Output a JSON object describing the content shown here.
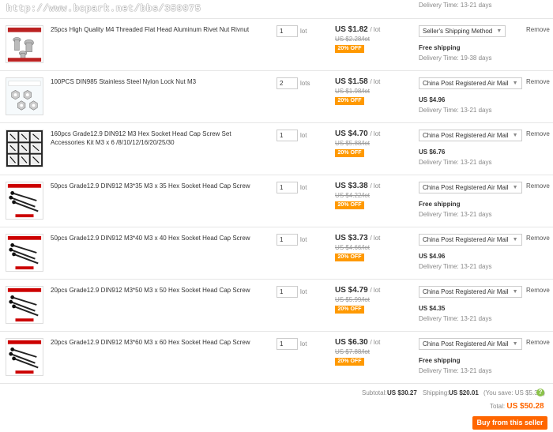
{
  "watermark": "http://www.bcpark.net/bbs/359975",
  "top_delivery": "Delivery Time: 13-21 days",
  "items": [
    {
      "title": "25pcs High Quality M4 Threaded Flat Head Aluminum Rivet Nut Rivnut",
      "qty": "1",
      "unit": "lot",
      "price": "US $1.82",
      "per": "/ lot",
      "orig": "US $2.28/lot",
      "off": "20% OFF",
      "ship": "Seller's Shipping Method",
      "cost": "Free shipping",
      "delivery": "Delivery Time: 19-38 days",
      "remove": "Remove",
      "thumb": "rivet"
    },
    {
      "title": "100PCS DIN985 Stainless Steel Nylon Lock Nut M3",
      "qty": "2",
      "unit": "lots",
      "price": "US $1.58",
      "per": "/ lot",
      "orig": "US $1.98/lot",
      "off": "20% OFF",
      "ship": "China Post Registered Air Mail",
      "cost": "US $4.96",
      "delivery": "Delivery Time: 13-21 days",
      "remove": "Remove",
      "thumb": "nut"
    },
    {
      "title": "160pcs Grade12.9 DIN912 M3 Hex Socket Head Cap Screw Set Accessories Kit M3 x 6 /8/10/12/16/20/25/30",
      "qty": "1",
      "unit": "lot",
      "price": "US $4.70",
      "per": "/ lot",
      "orig": "US $5.88/lot",
      "off": "20% OFF",
      "ship": "China Post Registered Air Mail",
      "cost": "US $6.76",
      "delivery": "Delivery Time: 13-21 days",
      "remove": "Remove",
      "thumb": "kit"
    },
    {
      "title": "50pcs Grade12.9 DIN912 M3*35 M3 x 35 Hex Socket Head Cap Screw",
      "qty": "1",
      "unit": "lot",
      "price": "US $3.38",
      "per": "/ lot",
      "orig": "US $4.22/lot",
      "off": "20% OFF",
      "ship": "China Post Registered Air Mail",
      "cost": "Free shipping",
      "delivery": "Delivery Time: 13-21 days",
      "remove": "Remove",
      "thumb": "screw"
    },
    {
      "title": "50pcs Grade12.9 DIN912 M3*40 M3 x 40 Hex Socket Head Cap Screw",
      "qty": "1",
      "unit": "lot",
      "price": "US $3.73",
      "per": "/ lot",
      "orig": "US $4.66/lot",
      "off": "20% OFF",
      "ship": "China Post Registered Air Mail",
      "cost": "US $4.96",
      "delivery": "Delivery Time: 13-21 days",
      "remove": "Remove",
      "thumb": "screw"
    },
    {
      "title": "20pcs Grade12.9 DIN912 M3*50 M3 x 50 Hex Socket Head Cap Screw",
      "qty": "1",
      "unit": "lot",
      "price": "US $4.79",
      "per": "/ lot",
      "orig": "US $5.99/lot",
      "off": "20% OFF",
      "ship": "China Post Registered Air Mail",
      "cost": "US $4.35",
      "delivery": "Delivery Time: 13-21 days",
      "remove": "Remove",
      "thumb": "screw"
    },
    {
      "title": "20pcs Grade12.9 DIN912 M3*60 M3 x 60 Hex Socket Head Cap Screw",
      "qty": "1",
      "unit": "lot",
      "price": "US $6.30",
      "per": "/ lot",
      "orig": "US $7.88/lot",
      "off": "20% OFF",
      "ship": "China Post Registered Air Mail",
      "cost": "Free shipping",
      "delivery": "Delivery Time: 13-21 days",
      "remove": "Remove",
      "thumb": "screw"
    }
  ],
  "summary": {
    "subtotal_label": "Subtotal:",
    "subtotal": "US $30.27",
    "shipping_label": "Shipping:",
    "shipping": "US $20.01",
    "save": "(You save: US $5.37 )",
    "total_label": "Total:",
    "total": "US $50.28",
    "buy": "Buy from this seller"
  },
  "colors": {
    "accent": "#ff6600",
    "badge": "#ff9900",
    "help": "#8bc34a"
  }
}
